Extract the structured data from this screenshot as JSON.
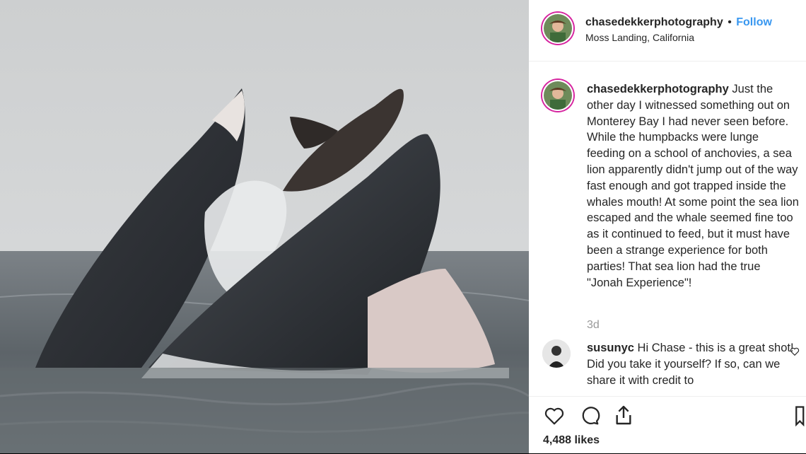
{
  "post": {
    "image_alt": "Humpback whales lunge feeding with a sea lion caught in a whale's mouth",
    "username": "chasedekkerphotography",
    "separator": "•",
    "follow_label": "Follow",
    "location": "Moss Landing, California",
    "caption_user": "chasedekkerphotography",
    "caption_text": " Just the other day I witnessed something out on Monterey Bay I had never seen before. While the humpbacks were lunge feeding on a school of anchovies, a sea lion apparently didn't jump out of the way fast enough and got trapped inside the whales mouth! At some point the sea lion escaped and the whale seemed fine too as it continued to feed, but it must have been a strange experience for both parties! That sea lion had the true \"Jonah Experience\"!",
    "time_ago": "3d",
    "comment": {
      "user": "susunyc",
      "text": " Hi Chase - this is a great shot! Did you take it yourself? If so, can we share it with credit to"
    },
    "likes": "4,488 likes"
  },
  "icons": [
    "heart-icon",
    "comment-icon",
    "share-icon",
    "comment-like-icon",
    "save-icon"
  ],
  "colors": {
    "follow": "#3897f0",
    "text": "#262626",
    "muted": "#999999",
    "story_ring": "#d6249f"
  }
}
